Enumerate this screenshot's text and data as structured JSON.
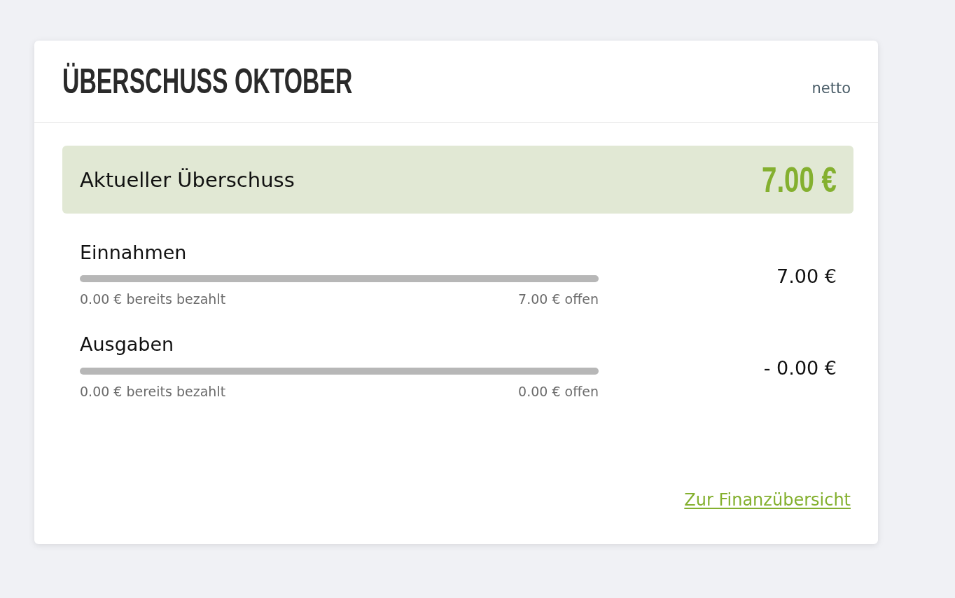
{
  "card": {
    "title": "ÜBERSCHUSS OKTOBER",
    "mode_label": "netto"
  },
  "summary": {
    "label": "Aktueller Überschuss",
    "amount": "7.00 €"
  },
  "rows": [
    {
      "label": "Einnahmen",
      "paid": "0.00 € bereits bezahlt",
      "open": "7.00 € offen",
      "amount": "7.00 €"
    },
    {
      "label": "Ausgaben",
      "paid": "0.00 € bereits bezahlt",
      "open": "0.00 € offen",
      "amount": "- 0.00 €"
    }
  ],
  "link": {
    "label": "Zur Finanzübersicht"
  }
}
